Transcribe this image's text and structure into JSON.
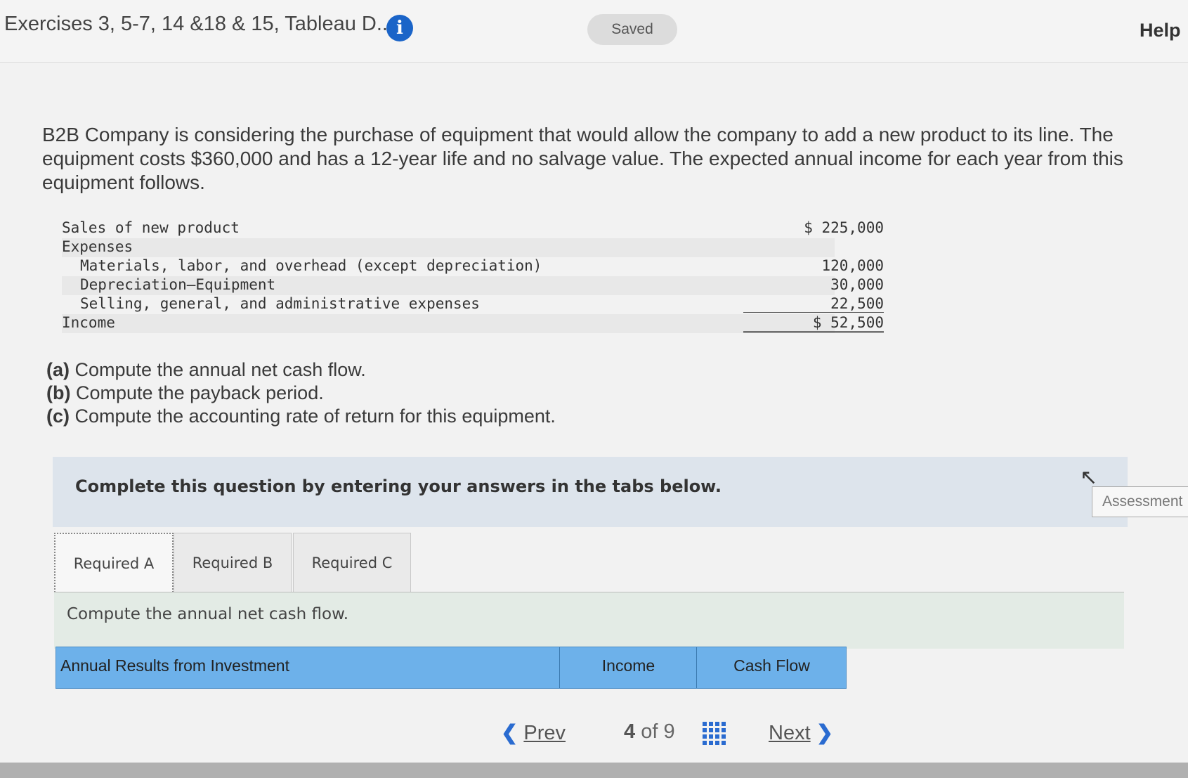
{
  "header": {
    "title": "Exercises 3, 5-7, 14 &18 & 15, Tableau D...",
    "info_icon": "info-icon",
    "saved": "Saved",
    "help": "Help"
  },
  "problem": {
    "text": "B2B Company is considering the purchase of equipment that would allow the company to add a new product to its line. The equipment costs $360,000 and has a 12-year life and no salvage value. The expected annual income for each year from this equipment follows."
  },
  "income_statement": {
    "rows": [
      {
        "label": "Sales of new product",
        "amount": "$ 225,000"
      },
      {
        "label": "Expenses",
        "amount": ""
      },
      {
        "label": "Materials, labor, and overhead (except depreciation)",
        "amount": "120,000"
      },
      {
        "label": "Depreciation–Equipment",
        "amount": "30,000"
      },
      {
        "label": "Selling, general, and administrative expenses",
        "amount": "22,500"
      },
      {
        "label": "Income",
        "amount": "$ 52,500"
      }
    ]
  },
  "requirements": [
    {
      "tag": "(a)",
      "text": "Compute the annual net cash flow."
    },
    {
      "tag": "(b)",
      "text": "Compute the payback period."
    },
    {
      "tag": "(c)",
      "text": "Compute the accounting rate of return for this equipment."
    }
  ],
  "instructions": "Complete this question by entering your answers in the tabs below.",
  "assessment": "Assessment",
  "tabs": [
    "Required A",
    "Required B",
    "Required C"
  ],
  "tab_panel": "Compute the annual net cash flow.",
  "results_table": {
    "col1": "Annual Results from Investment",
    "col2": "Income",
    "col3": "Cash Flow"
  },
  "nav": {
    "prev": "Prev",
    "current": "4",
    "of": "of",
    "total": "9",
    "next": "Next"
  }
}
